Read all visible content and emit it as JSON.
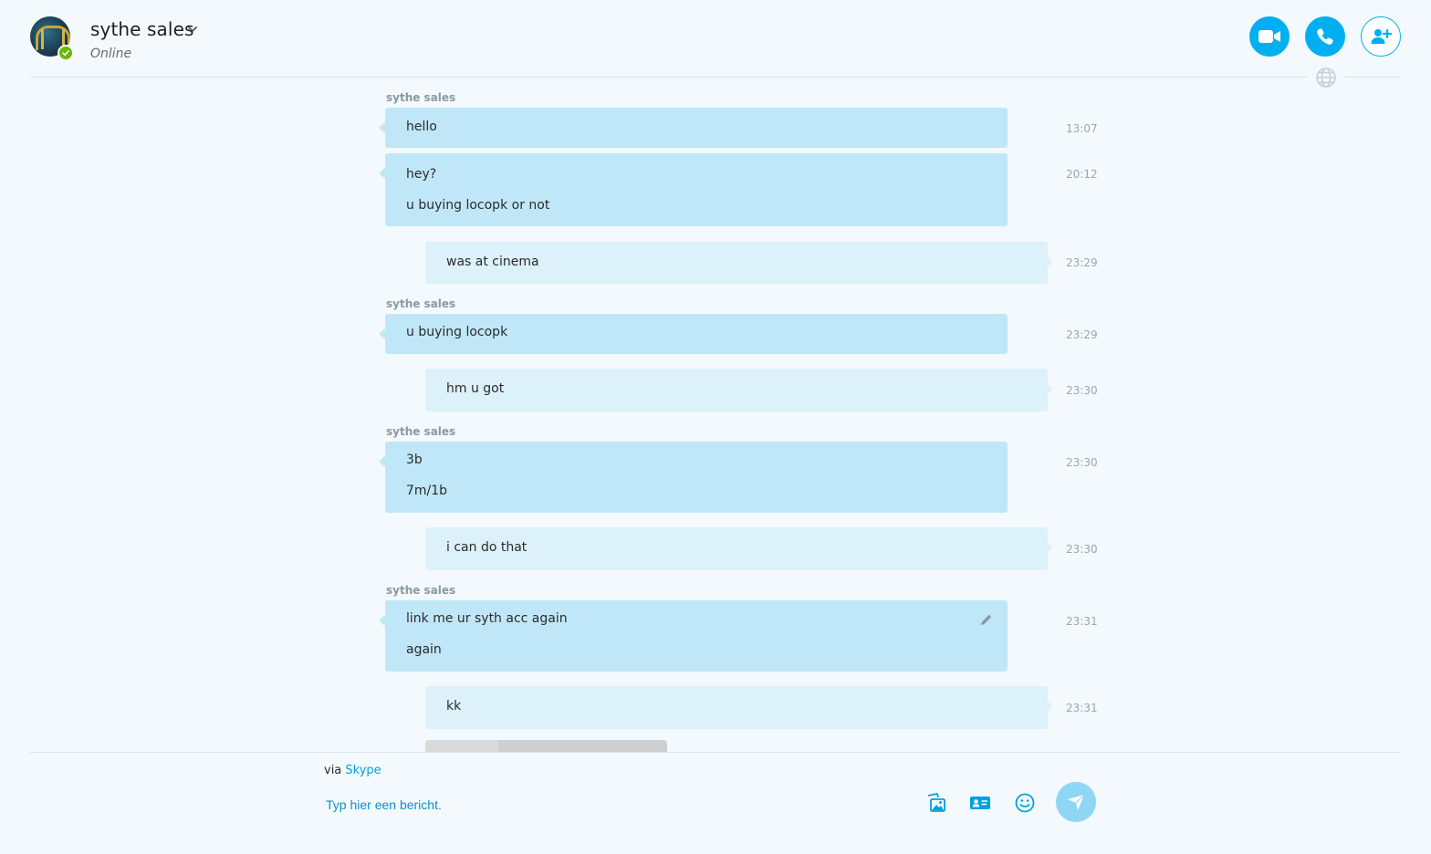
{
  "header": {
    "contact_name": "sythe sales",
    "status": "Online",
    "buttons": [
      {
        "icon": "video-camera-icon"
      },
      {
        "icon": "phone-icon"
      },
      {
        "icon": "add-person-icon"
      }
    ]
  },
  "messages": [
    {
      "sender": "sythe sales",
      "lines": [
        "hello"
      ],
      "time": "13:07",
      "direction": "incoming"
    },
    {
      "lines": [
        "hey?",
        "u buying locopk or not"
      ],
      "time": "20:12",
      "direction": "incoming"
    },
    {
      "lines": [
        "was at cinema"
      ],
      "time": "23:29",
      "direction": "outgoing"
    },
    {
      "sender": "sythe sales",
      "lines": [
        "u buying locopk"
      ],
      "time": "23:29",
      "direction": "incoming"
    },
    {
      "lines": [
        "hm u got"
      ],
      "time": "23:30",
      "direction": "outgoing"
    },
    {
      "sender": "sythe sales",
      "lines": [
        "3b",
        "7m/1b"
      ],
      "time": "23:30",
      "direction": "incoming"
    },
    {
      "lines": [
        "i can do that"
      ],
      "time": "23:30",
      "direction": "outgoing"
    },
    {
      "sender": "sythe sales",
      "lines": [
        "link me ur syth acc again",
        "again"
      ],
      "time": "23:31",
      "direction": "incoming",
      "edited": true
    },
    {
      "lines": [
        "kk"
      ],
      "time": "23:31",
      "direction": "outgoing"
    }
  ],
  "composer": {
    "via_prefix": "via",
    "via_link": "Skype",
    "placeholder": "Typ hier een bericht."
  },
  "colors": {
    "accent": "#00aff0",
    "incoming_bubble": "#c0e7f8",
    "outgoing_bubble": "#dcf1fa",
    "presence_online": "#6bb700"
  }
}
